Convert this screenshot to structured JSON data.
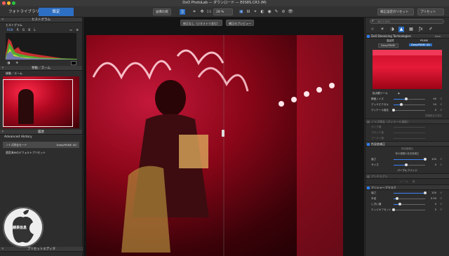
{
  "window": {
    "title": "DxO PhotoLab — ダウンロード — E0S8S.CR3 (M)"
  },
  "toolbar": {
    "tab_library": "フォトライブラリ",
    "tab_customize": "設定",
    "compare_label": "画像比較",
    "zoom_value": "28 %",
    "zoom_fit": "1:1",
    "reset_corrections": "補正設定のリセット",
    "presets": "プリセット"
  },
  "left": {
    "histogram": {
      "title": "ヒストグラム",
      "subtitle": "ヒストグラム",
      "channels": [
        "RGB",
        "R",
        "G",
        "B",
        "L"
      ]
    },
    "move_zoom": {
      "title": "移動／ズーム",
      "subtitle": "移動／ズーム"
    },
    "history": {
      "title": "履歴",
      "subtitle": "Advanced History",
      "items": [
        {
          "name": "ノイズ除去モード",
          "value": "DeepPRIME XD"
        },
        {
          "name": "適用済みのデフォルトプリセット",
          "value": ""
        }
      ]
    },
    "preset_editor": {
      "title": "プリセットエディタ",
      "label": "ン ー ル"
    }
  },
  "center": {
    "btn_before": "修正なし（ジオメトリ含む）",
    "btn_preview": "補正のプレビュー"
  },
  "right": {
    "search_placeholder": "補正を検索",
    "denoise": {
      "title": "DxO Denoising Technologies",
      "auto": "Auto",
      "modes": [
        "高品質",
        "PRIME"
      ],
      "deep": [
        "DeepPRIME",
        "DeepPRIME XD"
      ],
      "loupe": "拡大鏡ツール",
      "settings_link": "詳細設定を表示"
    },
    "sliders": [
      {
        "label": "輝度ノイズ",
        "value": "40",
        "pct": 0.4
      },
      {
        "label": "デッドピクセル",
        "value": "24",
        "pct": 0.24
      },
      {
        "label": "ディテール強化",
        "value": "0",
        "pct": 0
      }
    ],
    "dim_section": "ノイズ除去（ディテール強化）",
    "dim_sliders": [
      "ガンマ値",
      "ブロック量",
      "ゴースト値"
    ],
    "chromatic": {
      "title": "色収差補正",
      "subtitle1": "色収差補正",
      "subtitle2": "他の種類の色収差補正",
      "strength_label": "強さ",
      "strength_value": "100",
      "strength_pct": 1,
      "size_label": "サイズ",
      "size_value": "4",
      "size_pct": 0.4,
      "fringe": "パープルフリンジ"
    },
    "locked": {
      "title": "アンチモアレ",
      "sub": "ン ー ル"
    },
    "unsharp": {
      "title": "アンシャープマスク",
      "sliders": [
        {
          "label": "強さ",
          "value": "100",
          "pct": 1
        },
        {
          "label": "半径",
          "value": "0.50",
          "pct": 0.1
        },
        {
          "label": "しきい値",
          "value": "4",
          "pct": 0.2
        },
        {
          "label": "エッジオフセット",
          "value": "0",
          "pct": 0
        }
      ]
    }
  },
  "watermark": {
    "text": "蘋果信息"
  },
  "colors": {
    "accent": "#2d7ff9",
    "bg": "#2a2a2a",
    "panel": "#2d2d2d"
  }
}
